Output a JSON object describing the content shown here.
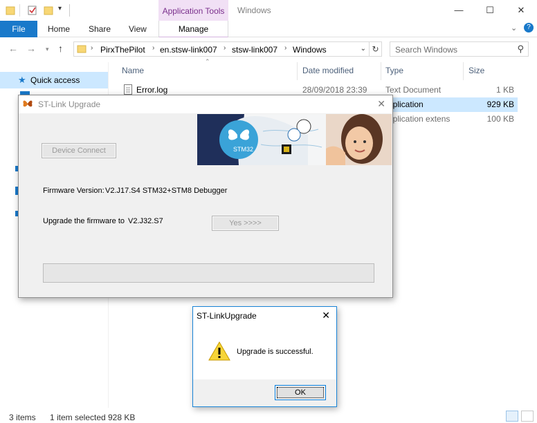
{
  "window": {
    "title": "Windows",
    "context_tab": "Application Tools",
    "controls": {
      "minimize": "—",
      "maximize": "☐",
      "close": "✕"
    }
  },
  "ribbon": {
    "file": "File",
    "home": "Home",
    "share": "Share",
    "view": "View",
    "manage": "Manage"
  },
  "address": {
    "crumbs": [
      "PirxThePilot",
      "en.stsw-link007",
      "stsw-link007",
      "Windows"
    ],
    "search_placeholder": "Search Windows"
  },
  "navpane": {
    "quick_access": "Quick access"
  },
  "columns": {
    "name": "Name",
    "date": "Date modified",
    "type": "Type",
    "size": "Size"
  },
  "files": [
    {
      "name": "Error.log",
      "date": "28/09/2018 23:39",
      "type": "Text Document",
      "size": "1 KB",
      "selected": false
    },
    {
      "name": "",
      "date": "",
      "type": "pplication",
      "size": "929 KB",
      "selected": true
    },
    {
      "name": "",
      "date": "",
      "type": "pplication extens",
      "size": "100 KB",
      "selected": false
    }
  ],
  "status": {
    "items": "3 items",
    "selected": "1 item selected",
    "size": "928 KB"
  },
  "stlink_dialog": {
    "title": "ST-Link Upgrade",
    "device_connect": "Device Connect",
    "firmware_label": "Firmware Version:",
    "firmware_value": "V2.J17.S4 STM32+STM8 Debugger",
    "upgrade_label": "Upgrade the firmware to",
    "upgrade_value": "V2.J32.S7",
    "yes_button": "Yes >>>>",
    "banner_logo": "STM32",
    "progress": 0
  },
  "message_box": {
    "title": "ST-LinkUpgrade",
    "message": "Upgrade is successful.",
    "ok": "OK",
    "icon": "warning-icon"
  },
  "colors": {
    "file_tab": "#1979ca",
    "context_tab_bg": "#f1e0f5",
    "context_tab_text": "#7a2f8c",
    "selection": "#cce8ff",
    "banner_navy": "#1f2f5a",
    "stm32_blue": "#3aa3d8"
  }
}
